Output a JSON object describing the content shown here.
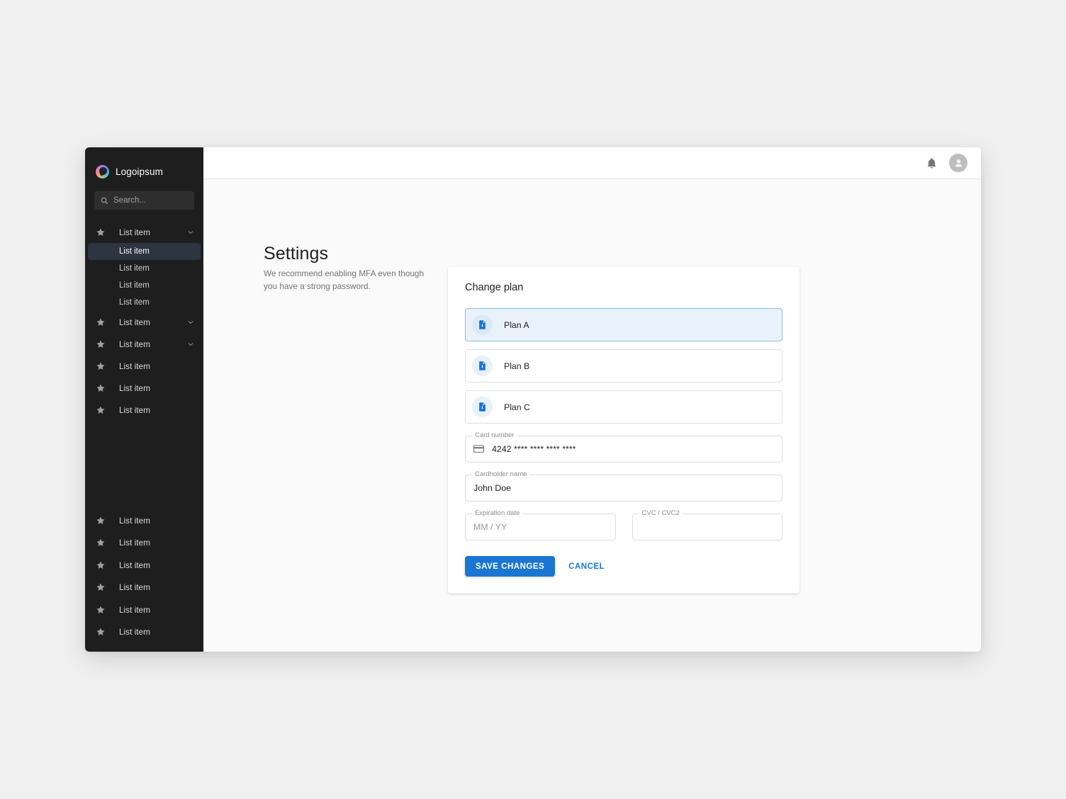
{
  "brand": {
    "name": "Logoipsum",
    "logo_icon": "swirl-logo-icon"
  },
  "search": {
    "placeholder": "Search...",
    "icon": "search-icon"
  },
  "sidebar": {
    "groups": [
      {
        "label": "List item",
        "icon": "star-icon",
        "chevron": "chevron-down-icon",
        "expanded": true,
        "children": [
          {
            "label": "List item",
            "selected": true
          },
          {
            "label": "List item",
            "selected": false
          },
          {
            "label": "List item",
            "selected": false
          },
          {
            "label": "List item",
            "selected": false
          }
        ]
      },
      {
        "label": "List item",
        "icon": "star-icon",
        "chevron": "chevron-down-icon",
        "expanded": false,
        "children": []
      },
      {
        "label": "List item",
        "icon": "star-icon",
        "chevron": "chevron-down-icon",
        "expanded": false,
        "children": []
      },
      {
        "label": "List item",
        "icon": "star-icon",
        "chevron": null,
        "expanded": false,
        "children": []
      },
      {
        "label": "List item",
        "icon": "star-icon",
        "chevron": null,
        "expanded": false,
        "children": []
      },
      {
        "label": "List item",
        "icon": "star-icon",
        "chevron": null,
        "expanded": false,
        "children": []
      }
    ],
    "bottom_items": [
      {
        "label": "List item",
        "icon": "star-icon"
      },
      {
        "label": "List item",
        "icon": "star-icon"
      },
      {
        "label": "List item",
        "icon": "star-icon"
      },
      {
        "label": "List item",
        "icon": "star-icon"
      },
      {
        "label": "List item",
        "icon": "star-icon"
      },
      {
        "label": "List item",
        "icon": "star-icon"
      }
    ]
  },
  "topbar": {
    "notification_icon": "bell-icon",
    "avatar_icon": "user-avatar-icon"
  },
  "page": {
    "title": "Settings",
    "subtitle": "We recommend enabling MFA even though you have a strong password."
  },
  "card": {
    "title": "Change plan",
    "plans": [
      {
        "label": "Plan A",
        "icon": "document-download-icon",
        "selected": true
      },
      {
        "label": "Plan B",
        "icon": "document-download-icon",
        "selected": false
      },
      {
        "label": "Plan C",
        "icon": "document-download-icon",
        "selected": false
      }
    ],
    "fields": {
      "card_number": {
        "label": "Card number",
        "value": "4242 **** **** **** ****",
        "icon": "credit-card-icon"
      },
      "cardholder_name": {
        "label": "Cardholder name",
        "value": "John Doe"
      },
      "expiration_date": {
        "label": "Expiration date",
        "value": "MM / YY",
        "is_placeholder": true
      },
      "cvc": {
        "label": "CVC / CVC2",
        "value": ""
      }
    },
    "actions": {
      "save_label": "SAVE CHANGES",
      "cancel_label": "CANCEL"
    }
  },
  "colors": {
    "accent": "#1a76d2",
    "sidebar_bg": "#1e1e1e",
    "sidebar_selected": "#2d3542",
    "page_bg": "#fafafa",
    "selected_plan_bg": "#e9f2fb",
    "selected_plan_border": "#8cbce6",
    "star_icon": "#9e9e9e"
  }
}
